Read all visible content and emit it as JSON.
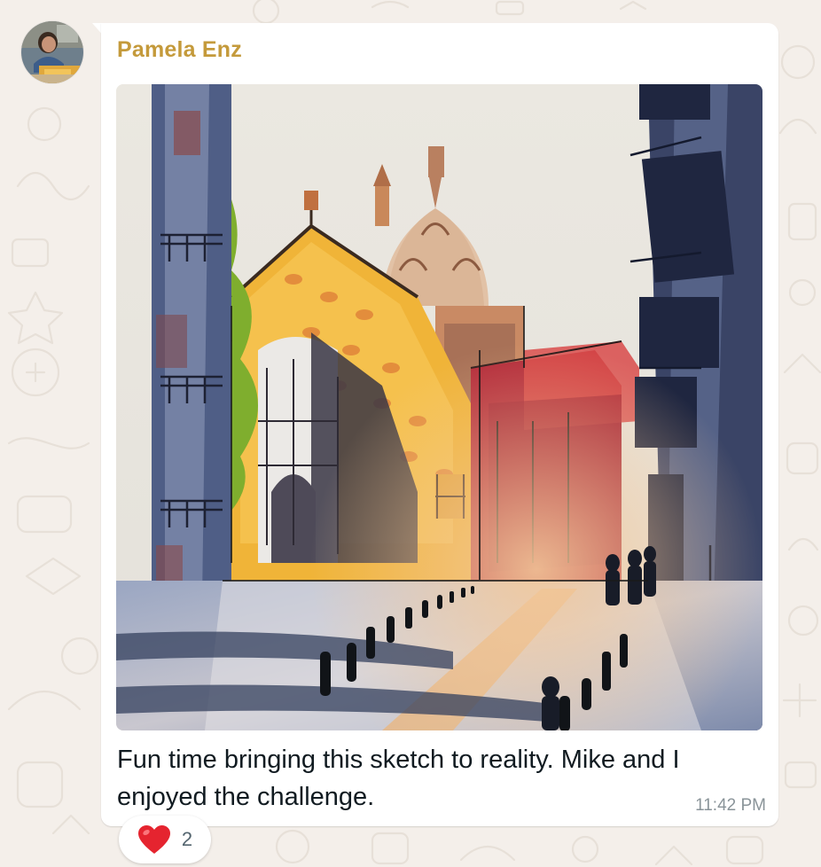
{
  "chat": {
    "background_color": "#f4efea",
    "bubble_color": "#ffffff"
  },
  "message": {
    "sender_name": "Pamela Enz",
    "sender_color": "#c49a3b",
    "avatar": "profile-photo",
    "image": "watercolor-street-sketch",
    "caption": "Fun time bringing this sketch to reality. Mike and I enjoyed the challenge.",
    "time": "11:42 PM",
    "reaction": {
      "emoji_icon": "red-heart-icon",
      "count": "2"
    }
  }
}
